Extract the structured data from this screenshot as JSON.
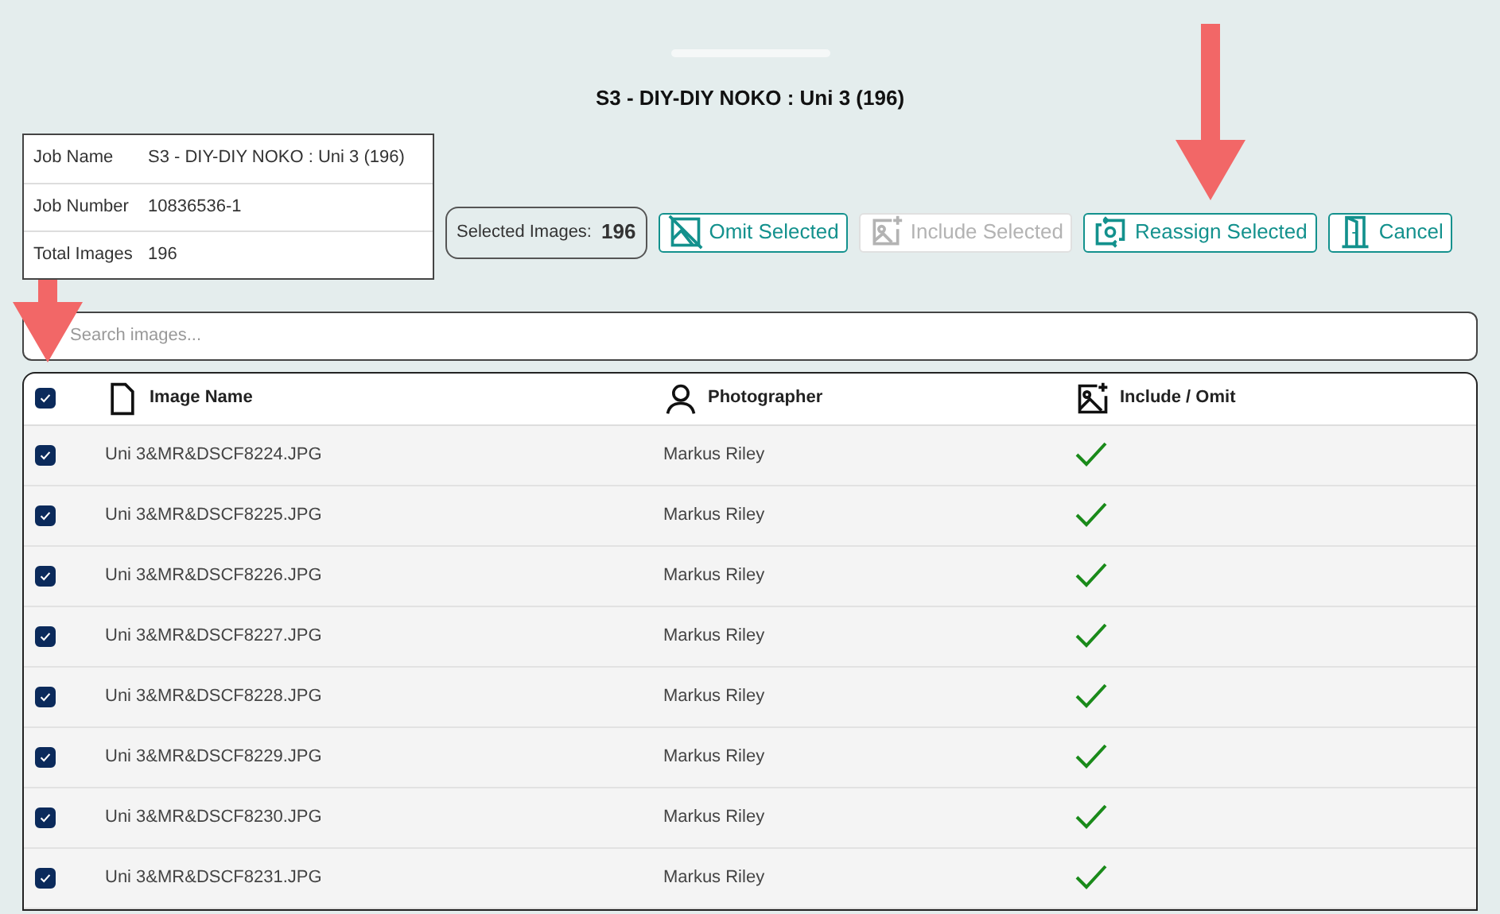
{
  "title": "S3 - DIY-DIY NOKO : Uni 3 (196)",
  "job_info": [
    {
      "label": "Job Name",
      "value": "S3 - DIY-DIY NOKO : Uni 3 (196)"
    },
    {
      "label": "Job Number",
      "value": "10836536-1"
    },
    {
      "label": "Total Images",
      "value": "196"
    }
  ],
  "selected_count": {
    "label": "Selected Images:",
    "value": "196"
  },
  "actions": [
    {
      "kind": "omit",
      "label": "Omit Selected",
      "disabled": false
    },
    {
      "kind": "include",
      "label": "Include Selected",
      "disabled": true
    },
    {
      "kind": "reassign",
      "label": "Reassign Selected",
      "disabled": false
    },
    {
      "kind": "cancel",
      "label": "Cancel",
      "disabled": false
    }
  ],
  "search": {
    "placeholder": "Search images..."
  },
  "table": {
    "select_all_checked": true,
    "columns": [
      {
        "kind": "file",
        "label": "Image Name"
      },
      {
        "kind": "person",
        "label": "Photographer"
      },
      {
        "kind": "image",
        "label": "Include / Omit"
      }
    ],
    "rows": [
      {
        "checked": true,
        "name": "Uni 3&MR&DSCF8224.JPG",
        "photographer": "Markus Riley",
        "included": true
      },
      {
        "checked": true,
        "name": "Uni 3&MR&DSCF8225.JPG",
        "photographer": "Markus Riley",
        "included": true
      },
      {
        "checked": true,
        "name": "Uni 3&MR&DSCF8226.JPG",
        "photographer": "Markus Riley",
        "included": true
      },
      {
        "checked": true,
        "name": "Uni 3&MR&DSCF8227.JPG",
        "photographer": "Markus Riley",
        "included": true
      },
      {
        "checked": true,
        "name": "Uni 3&MR&DSCF8228.JPG",
        "photographer": "Markus Riley",
        "included": true
      },
      {
        "checked": true,
        "name": "Uni 3&MR&DSCF8229.JPG",
        "photographer": "Markus Riley",
        "included": true
      },
      {
        "checked": true,
        "name": "Uni 3&MR&DSCF8230.JPG",
        "photographer": "Markus Riley",
        "included": true
      },
      {
        "checked": true,
        "name": "Uni 3&MR&DSCF8231.JPG",
        "photographer": "Markus Riley",
        "included": true
      }
    ]
  }
}
